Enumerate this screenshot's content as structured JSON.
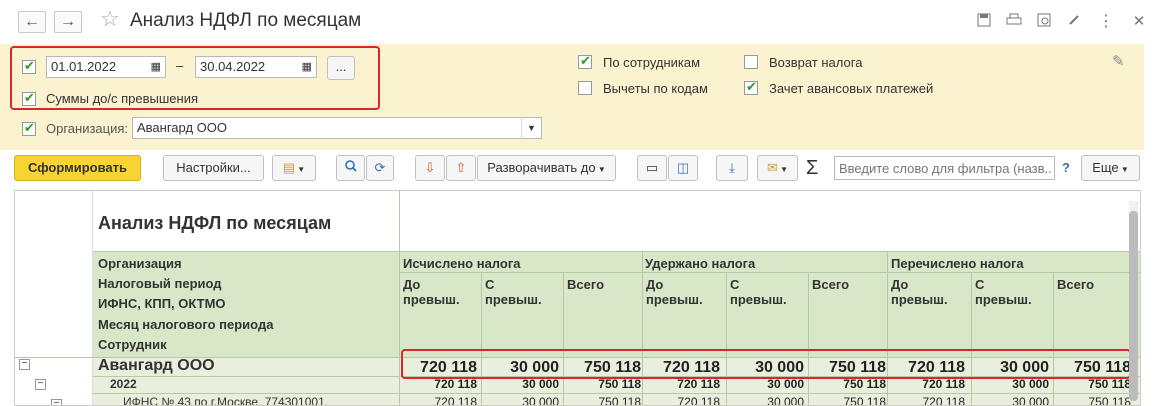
{
  "window": {
    "title": "Анализ НДФЛ по месяцам",
    "back": "←",
    "forward": "→",
    "star": "☆",
    "more": "⋮",
    "close": "✕"
  },
  "filters": {
    "date_from": "01.01.2022",
    "date_to": "30.04.2022",
    "dash": "–",
    "ellipsis": "...",
    "sums_label": "Суммы до/с превышения",
    "org_label": "Организация:",
    "org_value": "Авангард ООО",
    "by_employees": "По сотрудникам",
    "deductions_by_codes": "Вычеты по кодам",
    "tax_refund": "Возврат налога",
    "advance_offset": "Зачет авансовых платежей"
  },
  "toolbar": {
    "generate": "Сформировать",
    "settings": "Настройки...",
    "expand_to": "Разворачивать до",
    "search_placeholder": "Введите слово для фильтра (назв...",
    "help": "?",
    "more": "Еще",
    "sigma": "Σ"
  },
  "report": {
    "title": "Анализ НДФЛ по месяцам",
    "row_headers": [
      "Организация",
      "Налоговый период",
      "ИФНС, КПП, ОКТМО",
      "Месяц налогового периода",
      "Сотрудник"
    ],
    "groups": [
      "Исчислено налога",
      "Удержано налога",
      "Перечислено налога"
    ],
    "sub_headers": [
      "До\nпревыш.",
      "С\nпревыш.",
      "Всего"
    ],
    "rows": [
      {
        "label": "Авангард ООО",
        "values": [
          "720 118",
          "30 000",
          "750 118",
          "720 118",
          "30 000",
          "750 118",
          "720 118",
          "30 000",
          "750 118"
        ]
      },
      {
        "label": "2022",
        "values": [
          "720 118",
          "30 000",
          "750 118",
          "720 118",
          "30 000",
          "750 118",
          "720 118",
          "30 000",
          "750 118"
        ]
      },
      {
        "label": "ИФНС № 43 по г.Москве, 774301001,",
        "values": [
          "720 118",
          "30 000",
          "750 118",
          "720 118",
          "30 000",
          "750 118",
          "720 118",
          "30 000",
          "750 118"
        ]
      }
    ]
  },
  "colors": {
    "highlight": "#d9252b",
    "header_green": "#d9e7c9",
    "filter_bg": "#fbf3d0",
    "generate_btn": "#f7d433"
  }
}
